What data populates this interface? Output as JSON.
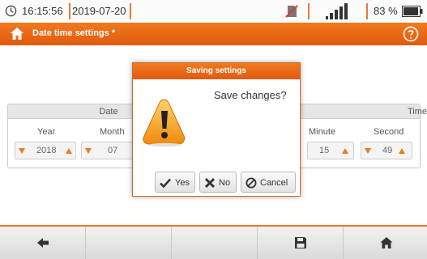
{
  "status": {
    "time": "16:15:56",
    "date": "2019-07-20",
    "battery_percent": "83 %",
    "icons": [
      "clock-icon",
      "no-sd-card-icon",
      "signal-icon",
      "battery-icon"
    ]
  },
  "titlebar": {
    "title": "Date time settings *",
    "icons": [
      "home-icon",
      "help-icon"
    ]
  },
  "date_panel": {
    "header": "Date",
    "columns": [
      {
        "label": "Year",
        "value": "2018"
      },
      {
        "label": "Month",
        "value": "07"
      }
    ]
  },
  "time_panel": {
    "header": "Time",
    "columns": [
      {
        "label": "Minute",
        "value": "15"
      },
      {
        "label": "Second",
        "value": "49"
      }
    ]
  },
  "dialog": {
    "title": "Saving settings",
    "message": "Save changes?",
    "icon": "warning-icon",
    "buttons": {
      "yes": "Yes",
      "no": "No",
      "cancel": "Cancel"
    }
  },
  "toolbar": {
    "icons": [
      "back-arrow-icon",
      "save-icon",
      "home-icon"
    ]
  },
  "colors": {
    "accent": "#ee7a22",
    "title_bar": "#e8661a"
  }
}
